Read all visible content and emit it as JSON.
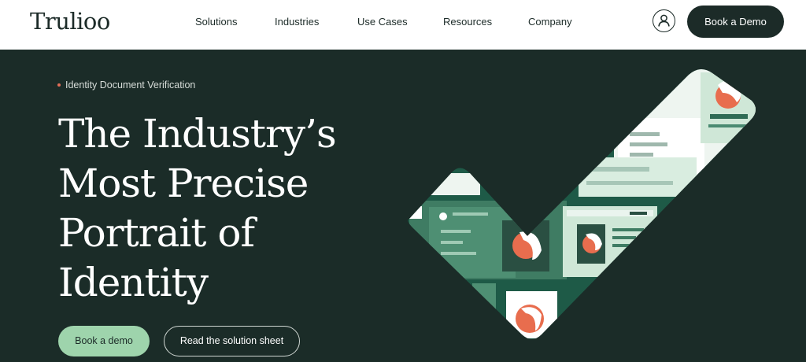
{
  "brand": {
    "logo_text": "Trulioo"
  },
  "nav": {
    "items": [
      {
        "label": "Solutions"
      },
      {
        "label": "Industries"
      },
      {
        "label": "Use Cases"
      },
      {
        "label": "Resources"
      },
      {
        "label": "Company"
      }
    ],
    "account_icon": "user-icon",
    "cta_label": "Book a Demo"
  },
  "hero": {
    "eyebrow": "Identity Document Verification",
    "headline_lines": [
      "The Industry’s",
      "Most Precise",
      "Portrait of",
      "Identity"
    ],
    "primary_cta": "Book a demo",
    "secondary_cta": "Read the solution sheet",
    "illustration_icon": "checkmark-identity-illustration"
  },
  "colors": {
    "background": "#1b2c28",
    "header_bg": "#ffffff",
    "accent_green": "#9ed4ac",
    "eyebrow_dot": "#e46e58"
  }
}
